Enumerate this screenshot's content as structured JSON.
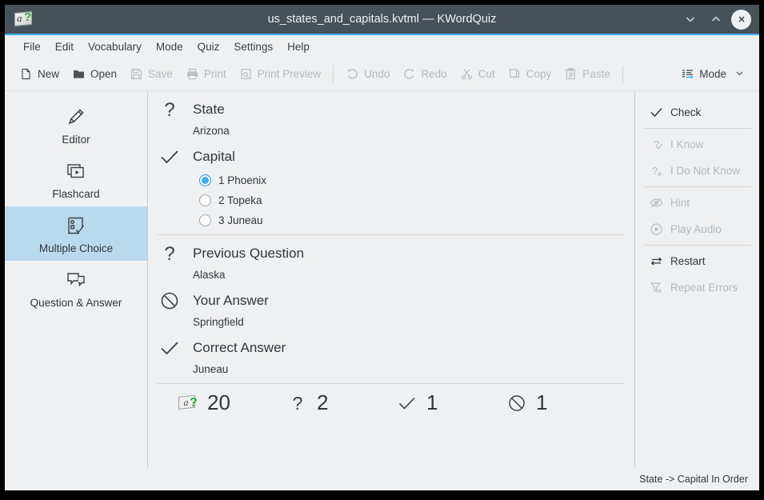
{
  "titlebar": {
    "title": "us_states_and_capitals.kvtml — KWordQuiz",
    "app_icon": "kwordquiz-icon",
    "minimize": "minimize-icon",
    "maximize": "maximize-icon",
    "close": "close-icon"
  },
  "menubar": {
    "items": [
      {
        "label": "File"
      },
      {
        "label": "Edit"
      },
      {
        "label": "Vocabulary"
      },
      {
        "label": "Mode"
      },
      {
        "label": "Quiz"
      },
      {
        "label": "Settings"
      },
      {
        "label": "Help"
      }
    ]
  },
  "toolbar": {
    "items": [
      {
        "label": "New",
        "icon": "document-icon",
        "enabled": true
      },
      {
        "label": "Open",
        "icon": "folder-icon",
        "enabled": true
      },
      {
        "label": "Save",
        "icon": "floppy-icon",
        "enabled": false
      },
      {
        "label": "Print",
        "icon": "printer-icon",
        "enabled": false
      },
      {
        "label": "Print Preview",
        "icon": "print-preview-icon",
        "enabled": false
      },
      {
        "label": "Undo",
        "icon": "undo-icon",
        "enabled": false
      },
      {
        "label": "Redo",
        "icon": "redo-icon",
        "enabled": false
      },
      {
        "label": "Cut",
        "icon": "scissors-icon",
        "enabled": false
      },
      {
        "label": "Copy",
        "icon": "copy-icon",
        "enabled": false
      },
      {
        "label": "Paste",
        "icon": "clipboard-icon",
        "enabled": false
      },
      {
        "label": "Mode",
        "icon": "mode-list-icon",
        "enabled": true
      }
    ]
  },
  "sidebar": {
    "items": [
      {
        "label": "Editor",
        "icon": "pencil-icon",
        "active": false
      },
      {
        "label": "Flashcard",
        "icon": "flashcard-icon",
        "active": false
      },
      {
        "label": "Multiple Choice",
        "icon": "multiple-choice-icon",
        "active": true
      },
      {
        "label": "Question & Answer",
        "icon": "speech-bubbles-icon",
        "active": false
      }
    ]
  },
  "quiz": {
    "question": {
      "label": "State",
      "icon": "question-mark-icon",
      "value": "Arizona"
    },
    "answer": {
      "label": "Capital",
      "icon": "check-icon",
      "choices": [
        {
          "label": "1 Phoenix",
          "selected": true
        },
        {
          "label": "2 Topeka",
          "selected": false
        },
        {
          "label": "3 Juneau",
          "selected": false
        }
      ]
    },
    "previous_question": {
      "label": "Previous Question",
      "icon": "question-mark-icon",
      "value": "Alaska"
    },
    "your_answer": {
      "label": "Your Answer",
      "icon": "no-entry-icon",
      "value": "Springfield"
    },
    "correct_answer": {
      "label": "Correct Answer",
      "icon": "check-icon",
      "value": "Juneau"
    }
  },
  "score": {
    "total": {
      "icon": "kwordquiz-icon",
      "value": "20"
    },
    "remaining": {
      "icon": "question-mark-icon",
      "value": "2"
    },
    "correct": {
      "icon": "check-icon",
      "value": "1"
    },
    "incorrect": {
      "icon": "no-entry-icon",
      "value": "1"
    }
  },
  "actions": {
    "items": [
      {
        "label": "Check",
        "icon": "check-icon",
        "enabled": true
      },
      {
        "label": "I Know",
        "icon": "question-check-icon",
        "enabled": false
      },
      {
        "label": "I Do Not Know",
        "icon": "question-x-icon",
        "enabled": false
      },
      {
        "label": "Hint",
        "icon": "hint-eye-off-icon",
        "enabled": false
      },
      {
        "label": "Play Audio",
        "icon": "play-circle-icon",
        "enabled": false
      },
      {
        "label": "Restart",
        "icon": "restart-arrows-icon",
        "enabled": true
      },
      {
        "label": "Repeat Errors",
        "icon": "funnel-x-icon",
        "enabled": false
      }
    ]
  },
  "statusbar": {
    "text": "State -> Capital In Order"
  },
  "colors": {
    "titlebar_bg": "#475159",
    "accent": "#3daee9",
    "window_bg": "#eff0f1",
    "selection_bg": "#bbd9ed",
    "text": "#31363b",
    "disabled_text": "#b3b9bd",
    "icon_green": "#3aa545"
  }
}
